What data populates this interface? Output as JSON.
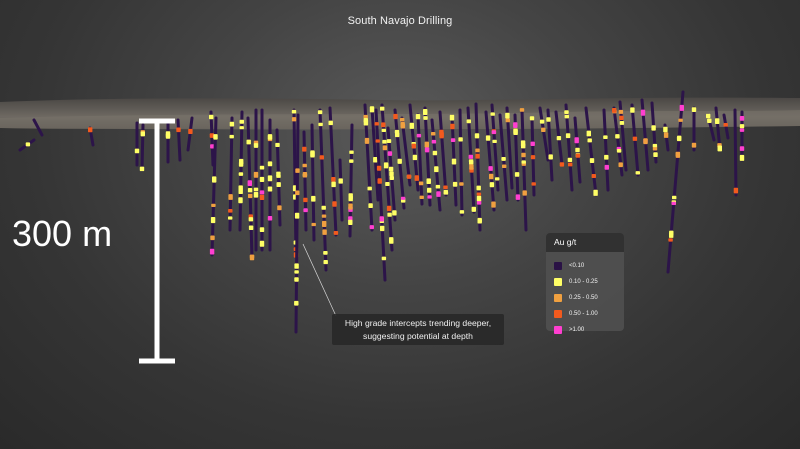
{
  "title": "South Navajo Drilling",
  "scale_bar": {
    "label": "300 m"
  },
  "annotation": {
    "line1": "High grade intercepts trending deeper,",
    "line2": "suggesting potential at depth"
  },
  "legend": {
    "title": "Au g/t",
    "items": [
      {
        "label": "<0.10",
        "color": "#2a1245",
        "icon": "purple-swatch"
      },
      {
        "label": "0.10 - 0.25",
        "color": "#ffff66",
        "icon": "yellow-swatch"
      },
      {
        "label": "0.25 - 0.50",
        "color": "#f0a040",
        "icon": "orange-swatch"
      },
      {
        "label": "0.50 - 1.00",
        "color": "#f25a1e",
        "icon": "red-orange-swatch"
      },
      {
        "label": ">1.00",
        "color": "#ff3fd0",
        "icon": "magenta-swatch"
      }
    ]
  },
  "colors": {
    "hole": "#2c1449",
    "terrain": "#5b5650",
    "scale": "#ffffff"
  }
}
